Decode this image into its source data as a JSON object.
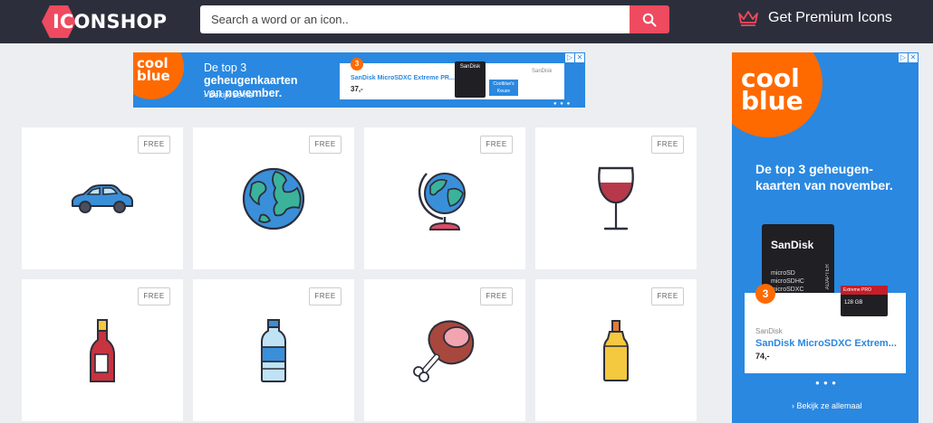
{
  "header": {
    "logo_text": "ICONSHOP",
    "search_placeholder": "Search a word or an icon..",
    "premium_label": "Get Premium Icons",
    "colors": {
      "bar": "#2c2f3b",
      "accent": "#ee4a60"
    }
  },
  "ads": {
    "top": {
      "brand": "cool blue",
      "headline_plain": "De top 3 ",
      "headline_bold": "geheugenkaarten",
      "headline_plain2": "van ",
      "headline_bold2": "november.",
      "cta": "› Bekijk ze nu",
      "badge": "3",
      "product": "SanDisk MicroSDXC Extreme PR...",
      "price": "37,-",
      "keuze": "Coolblue's Keuze",
      "card_brand": "SanDisk"
    },
    "side": {
      "brand": "cool blue",
      "headline_plain": "De top 3 ",
      "headline_bold": "geheugen-kaarten",
      "headline_plain2": " van ",
      "headline_bold2": "november.",
      "card_brand": "SanDisk",
      "card_lines": "microSD\nmicroSDHC\nmicroSDXC",
      "adapter": "ADAPTER",
      "mini_label": "Extreme PRO",
      "mini_cap": "128 GB",
      "badge": "3",
      "product": "SanDisk MicroSDXC Extrem...",
      "price": "74,-",
      "cta": "› Bekijk ze allemaal"
    }
  },
  "grid": {
    "free_label": "FREE",
    "items": [
      {
        "icon": "car-icon"
      },
      {
        "icon": "earth-icon"
      },
      {
        "icon": "globe-icon"
      },
      {
        "icon": "wine-glass-icon"
      },
      {
        "icon": "wine-bottle-icon"
      },
      {
        "icon": "water-bottle-icon"
      },
      {
        "icon": "ham-icon"
      },
      {
        "icon": "mustard-bottle-icon"
      }
    ]
  }
}
